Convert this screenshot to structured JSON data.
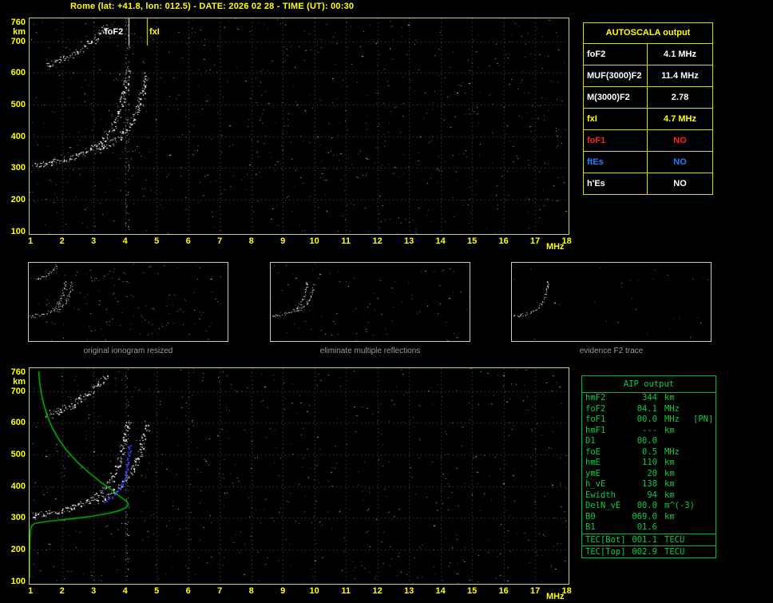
{
  "header": {
    "title": "Rome (lat: +41.8, lon: 012.5) - DATE: 2026 02 28 - TIME (UT): 00:30"
  },
  "colors": {
    "background": "#000000",
    "accent_yellow": "#ffff00",
    "plot_border": "#cfcf6e",
    "grid": "#5a5a5a",
    "trace_white": "#ffffff",
    "profile_green": "#00cc00",
    "blue_trace": "#3a3aff",
    "autoscala_border": "#d6d600",
    "aip_green": "#00cc44",
    "no_red": "#ff2020",
    "no_blue": "#2080ff",
    "caption_gray": "#9a9a9a"
  },
  "ionogram": {
    "x_ticks": [
      1,
      2,
      3,
      4,
      5,
      6,
      7,
      8,
      9,
      10,
      11,
      12,
      13,
      14,
      15,
      16,
      17,
      18
    ],
    "y_ticks": [
      760,
      700,
      600,
      500,
      400,
      300,
      200,
      100
    ],
    "x_unit": "MHz",
    "y_unit": "km",
    "x_range": [
      1,
      18
    ],
    "y_range": [
      100,
      760
    ]
  },
  "geom": {
    "fmin": 0.97,
    "fmax": 18.06,
    "hmin": 92,
    "hmax": 772
  },
  "plots": {
    "top": {
      "seed": 7,
      "noise": 720,
      "grid": true,
      "traces": [
        "f2_ordinary",
        "f2_extraordinary",
        "second_hop"
      ],
      "bands": [
        {
          "f": 4.06,
          "count": 80
        }
      ],
      "markers": [
        {
          "f": 4.1,
          "color": "#ffffff",
          "label": "foF2"
        },
        {
          "f": 4.68,
          "color": "#ffff00",
          "label": "fxI"
        }
      ]
    },
    "bottom": {
      "seed": 13,
      "noise": 620,
      "grid": true,
      "traces": [
        "f2_ordinary",
        "f2_extraordinary",
        "second_hop"
      ],
      "bands": [
        {
          "f": 4.06,
          "count": 55
        }
      ],
      "profile": true,
      "blue": true
    }
  },
  "traces": {
    "f2_ordinary": [
      [
        1.05,
        308
      ],
      [
        1.35,
        312
      ],
      [
        1.7,
        318
      ],
      [
        2.1,
        327
      ],
      [
        2.5,
        340
      ],
      [
        2.85,
        356
      ],
      [
        3.15,
        376
      ],
      [
        3.4,
        400
      ],
      [
        3.6,
        430
      ],
      [
        3.75,
        462
      ],
      [
        3.87,
        497
      ],
      [
        3.96,
        533
      ],
      [
        4.02,
        565
      ],
      [
        4.07,
        592
      ],
      [
        4.1,
        612
      ]
    ],
    "f2_extraordinary": [
      [
        3.1,
        352
      ],
      [
        3.45,
        370
      ],
      [
        3.75,
        392
      ],
      [
        4.0,
        416
      ],
      [
        4.2,
        444
      ],
      [
        4.35,
        475
      ],
      [
        4.47,
        508
      ],
      [
        4.56,
        540
      ],
      [
        4.63,
        572
      ],
      [
        4.68,
        600
      ]
    ],
    "second_hop": [
      [
        1.5,
        628
      ],
      [
        1.9,
        640
      ],
      [
        2.3,
        656
      ],
      [
        2.65,
        678
      ],
      [
        2.95,
        702
      ],
      [
        3.2,
        726
      ],
      [
        3.42,
        750
      ]
    ]
  },
  "profile": [
    [
      1.26,
      762
    ],
    [
      1.29,
      728
    ],
    [
      1.34,
      694
    ],
    [
      1.42,
      658
    ],
    [
      1.53,
      622
    ],
    [
      1.68,
      586
    ],
    [
      1.88,
      550
    ],
    [
      2.14,
      514
    ],
    [
      2.46,
      478
    ],
    [
      2.84,
      444
    ],
    [
      3.24,
      412
    ],
    [
      3.6,
      386
    ],
    [
      3.88,
      364
    ],
    [
      4.05,
      352
    ],
    [
      4.1,
      344
    ],
    [
      4.04,
      333
    ],
    [
      3.82,
      323
    ],
    [
      3.45,
      314
    ],
    [
      2.95,
      305
    ],
    [
      2.38,
      298
    ],
    [
      1.8,
      292
    ],
    [
      1.38,
      287
    ],
    [
      1.12,
      282
    ],
    [
      1.03,
      274
    ],
    [
      1.0,
      262
    ],
    [
      0.99,
      246
    ],
    [
      0.98,
      228
    ],
    [
      0.98,
      208
    ],
    [
      0.97,
      188
    ],
    [
      0.97,
      168
    ],
    [
      0.97,
      148
    ],
    [
      0.97,
      128
    ],
    [
      0.97,
      110
    ]
  ],
  "blue_trace": [
    [
      3.35,
      352
    ],
    [
      3.55,
      366
    ],
    [
      3.72,
      383
    ],
    [
      3.86,
      403
    ],
    [
      3.97,
      428
    ],
    [
      4.04,
      456
    ],
    [
      4.09,
      486
    ],
    [
      4.12,
      514
    ],
    [
      4.14,
      538
    ]
  ],
  "thumbs": [
    {
      "caption": "original ionogram resized",
      "seed": 21,
      "noise": 150,
      "small": true,
      "traces": [
        "f2_ordinary",
        "f2_extraordinary",
        "second_hop"
      ]
    },
    {
      "caption": "eliminate multiple reflections",
      "seed": 22,
      "noise": 85,
      "small": true,
      "traces": [
        "f2_ordinary",
        "f2_extraordinary"
      ]
    },
    {
      "caption": "evidence F2 trace",
      "seed": 23,
      "noise": 28,
      "small": true,
      "traces": [
        "f2_ordinary"
      ]
    }
  ],
  "autoscala": {
    "title": "AUTOSCALA output",
    "rows": [
      {
        "param": "foF2",
        "value": "4.1 MHz",
        "color": "#ffffff"
      },
      {
        "param": "MUF(3000)F2",
        "value": "11.4 MHz",
        "color": "#ffffff"
      },
      {
        "param": "M(3000)F2",
        "value": "2.78",
        "color": "#ffffff"
      },
      {
        "param": "fxI",
        "value": "4.7 MHz",
        "color": "#ffff00"
      },
      {
        "param": "foF1",
        "value": "NO",
        "color": "#ff2020"
      },
      {
        "param": "ftEs",
        "value": "NO",
        "color": "#2080ff"
      },
      {
        "param": "h'Es",
        "value": "NO",
        "color": "#ffffff"
      }
    ]
  },
  "aip": {
    "title": "AIP output",
    "rows": [
      {
        "name": "hmF2",
        "value": "344",
        "unit": "km",
        "extra": ""
      },
      {
        "name": "foF2",
        "value": "04.1",
        "unit": "MHz",
        "extra": ""
      },
      {
        "name": "foF1",
        "value": "00.0",
        "unit": "MHz",
        "extra": "[PN]"
      },
      {
        "name": "hmF1",
        "value": "---",
        "unit": "km",
        "extra": ""
      },
      {
        "name": "D1",
        "value": "00.0",
        "unit": "",
        "extra": ""
      },
      {
        "name": "foE",
        "value": "0.5",
        "unit": "MHz",
        "extra": ""
      },
      {
        "name": "hmE",
        "value": "110",
        "unit": "km",
        "extra": ""
      },
      {
        "name": "ymE",
        "value": "20",
        "unit": "km",
        "extra": ""
      },
      {
        "name": "h_vE",
        "value": "138",
        "unit": "km",
        "extra": ""
      },
      {
        "name": "Ewidth",
        "value": "94",
        "unit": "km",
        "extra": ""
      },
      {
        "name": "DelN_vE",
        "value": "00.0",
        "unit": "m^(-3)",
        "extra": ""
      },
      {
        "name": "B0",
        "value": "069.0",
        "unit": "km",
        "extra": ""
      },
      {
        "name": "B1",
        "value": "01.6",
        "unit": "",
        "extra": ""
      }
    ],
    "tec_rows": [
      {
        "name": "TEC[Bot]",
        "value": "001.1",
        "unit": "TECU",
        "extra": ""
      },
      {
        "name": "TEC[Top]",
        "value": "002.9",
        "unit": "TECU",
        "extra": ""
      }
    ]
  }
}
